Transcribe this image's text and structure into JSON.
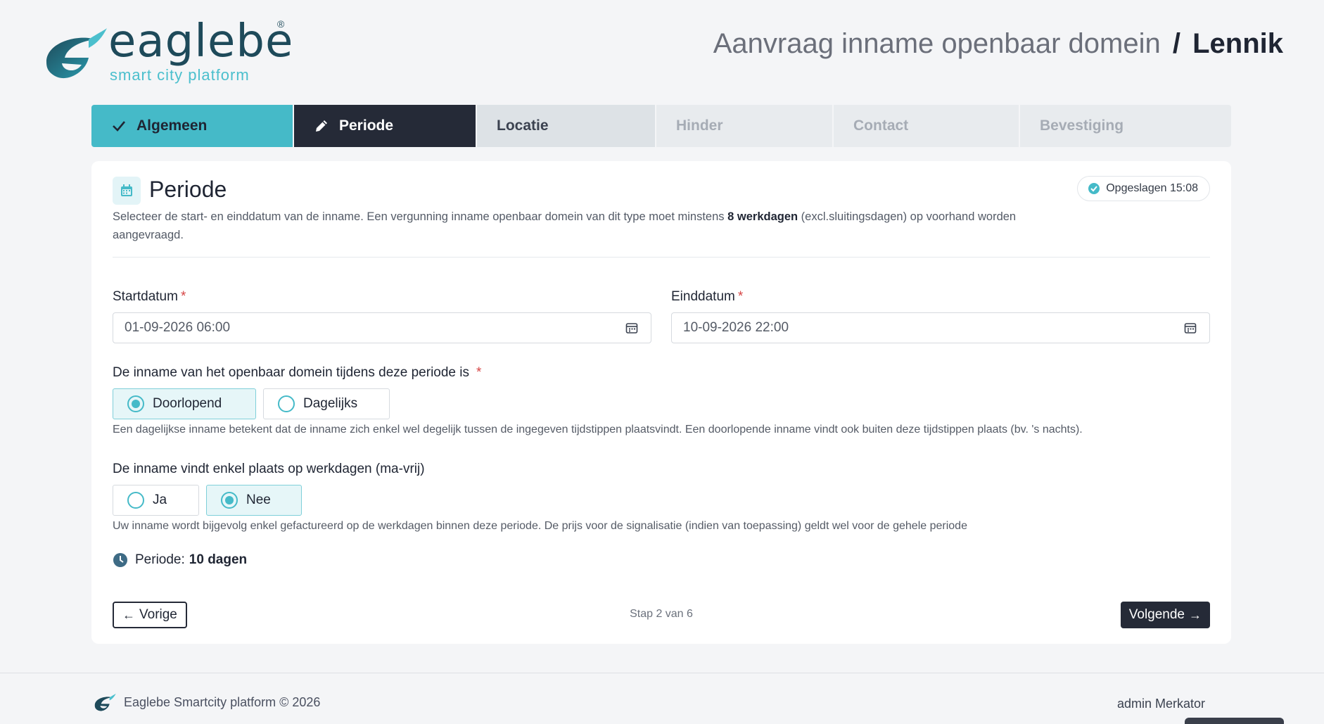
{
  "brand": {
    "name": "eaglebe",
    "registered": "®",
    "tagline": "smart city platform"
  },
  "header": {
    "request_title": "Aanvraag inname openbaar domein",
    "separator": "/",
    "municipality": "Lennik"
  },
  "steps": [
    {
      "label": "Algemeen",
      "state": "done",
      "icon": "check-icon"
    },
    {
      "label": "Periode",
      "state": "active",
      "icon": "pencil-icon"
    },
    {
      "label": "Locatie",
      "state": "next"
    },
    {
      "label": "Hinder",
      "state": "future"
    },
    {
      "label": "Contact",
      "state": "future"
    },
    {
      "label": "Bevestiging",
      "state": "future"
    }
  ],
  "card": {
    "icon": "calendar-icon",
    "title": "Periode",
    "saved_badge": "Opgeslagen 15:08",
    "description_pre": "Selecteer de start- en einddatum van de inname. Een vergunning inname openbaar domein van dit type moet minstens ",
    "description_bold": "8 werkdagen",
    "description_post": " (excl.sluitingsdagen) op voorhand worden aangevraagd."
  },
  "form": {
    "start": {
      "label": "Startdatum",
      "required": "*",
      "value": "01-09-2026 06:00"
    },
    "end": {
      "label": "Einddatum",
      "required": "*",
      "value": "10-09-2026 22:00"
    },
    "occupation_type": {
      "label": "De inname van het openbaar domein tijdens deze periode is",
      "required": "*",
      "options": [
        "Doorlopend",
        "Dagelijks"
      ],
      "selected": "Doorlopend",
      "hint": "Een dagelijkse inname betekent dat de inname zich enkel wel degelijk tussen de ingegeven tijdstippen plaatsvindt. Een doorlopende inname vindt ook buiten deze tijdstippen plaats (bv. 's nachts)."
    },
    "workdays_only": {
      "label": "De inname vindt enkel plaats op werkdagen (ma-vrij)",
      "options": [
        "Ja",
        "Nee"
      ],
      "selected": "Nee",
      "hint": "Uw inname wordt bijgevolg enkel gefactureerd op de werkdagen binnen deze periode. De prijs voor de signalisatie (indien van toepassing) geldt wel voor de gehele periode"
    },
    "period_summary": {
      "label": "Periode:",
      "value": "10 dagen"
    }
  },
  "nav": {
    "prev": "Vorige",
    "next": "Volgende",
    "step_counter": "Stap 2 van 6"
  },
  "footer": {
    "copyright": "Eaglebe Smartcity platform © 2026",
    "user": "admin Merkator"
  },
  "colors": {
    "accent": "#45bac8",
    "dark": "#252a37",
    "brand": "#1e4a5a"
  }
}
